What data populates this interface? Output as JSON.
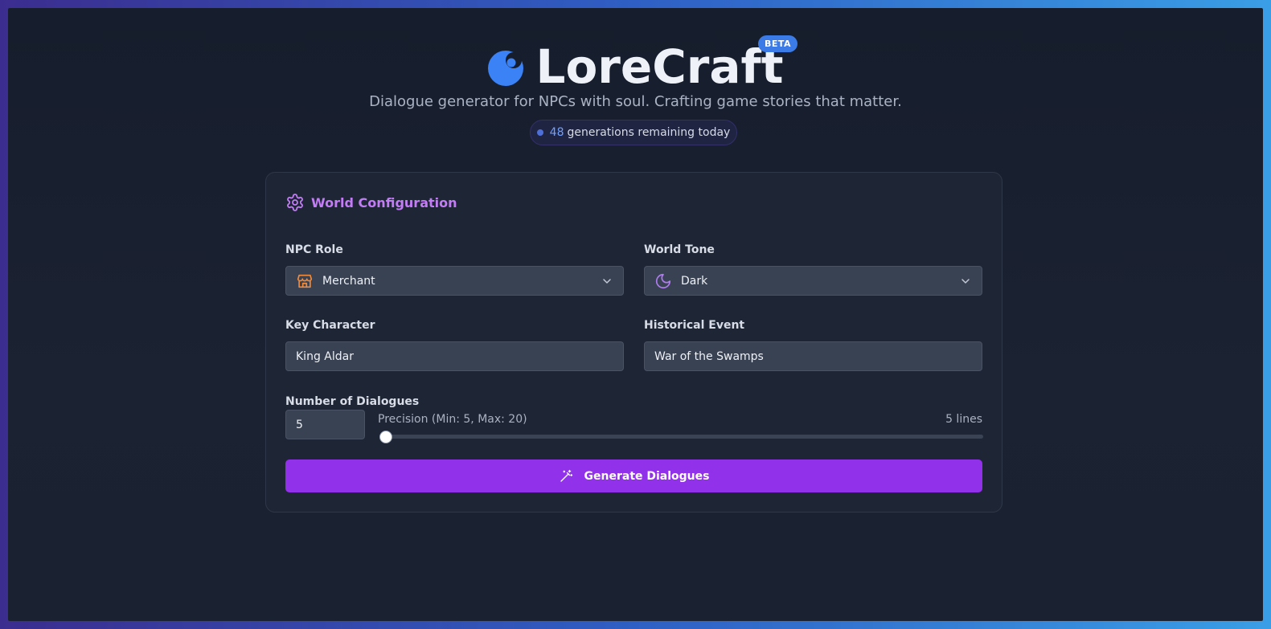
{
  "app": {
    "title": "LoreCraft",
    "badge": "BETA",
    "subtitle": "Dialogue generator for NPCs with soul. Crafting game stories that matter.",
    "quota_count": "48",
    "quota_text": "generations remaining today",
    "logo_icon": "moon-orb-icon",
    "accent": "#9131ea",
    "badge_color": "#3b7be8"
  },
  "config": {
    "title": "World Configuration",
    "title_icon": "gear-icon",
    "npc_role": {
      "label": "NPC Role",
      "value": "Merchant",
      "icon": "store-icon"
    },
    "world_tone": {
      "label": "World Tone",
      "value": "Dark",
      "icon": "moon-icon"
    },
    "key_character": {
      "label": "Key Character",
      "value": "King Aldar"
    },
    "historical_event": {
      "label": "Historical Event",
      "value": "War of the Swamps"
    },
    "dialogues": {
      "label": "Number of Dialogues",
      "value": "5",
      "precision_text": "Precision (Min: 5, Max: 20)",
      "lines_text": "5 lines",
      "min": 5,
      "max": 20,
      "current": 5
    },
    "generate_label": "Generate Dialogues",
    "generate_icon": "magic-wand-icon"
  }
}
